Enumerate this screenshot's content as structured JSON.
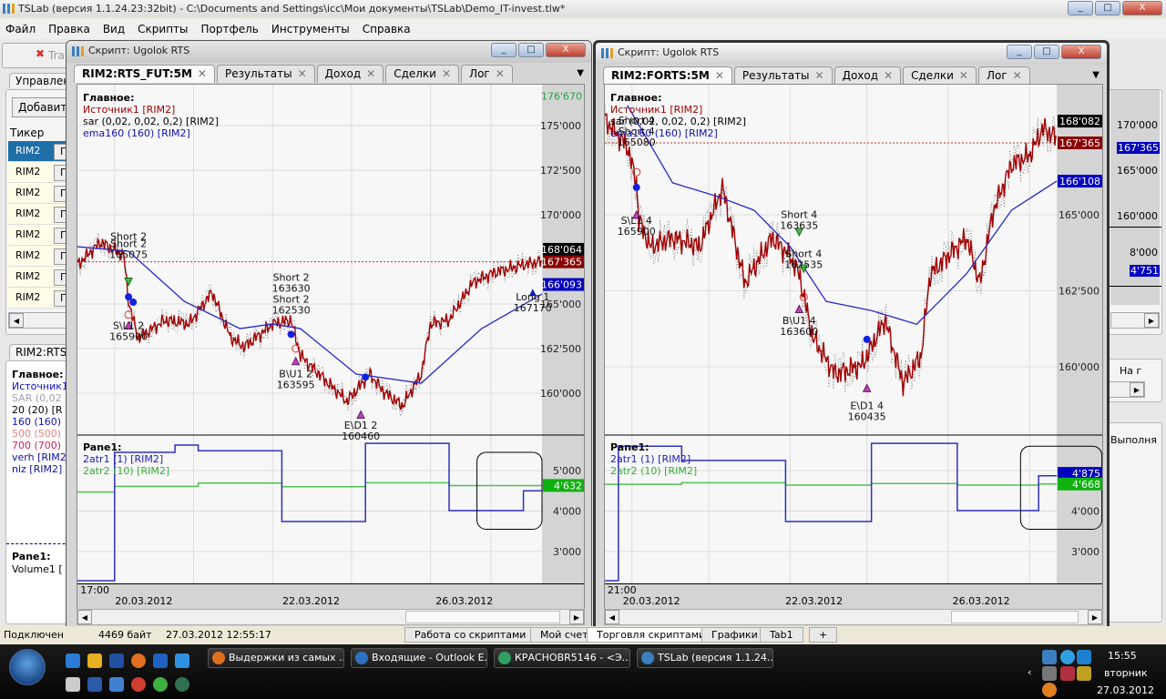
{
  "app": {
    "title": "TSLab (версия 1.1.24.23:32bit) - C:\\Documents and Settings\\icc\\Мои документы\\TSLab\\Demo_IT-invest.tlw*",
    "controls": [
      "_",
      "□",
      "X"
    ]
  },
  "menu": [
    "Файл",
    "Правка",
    "Вид",
    "Скрипты",
    "Портфель",
    "Инструменты",
    "Справка"
  ],
  "bg": {
    "toolbar_button": "Tra",
    "tab_top": "Управлен",
    "add_button": "Добавить",
    "ticker_header": "Тикер",
    "tickers": [
      "RIM2",
      "RIM2",
      "RIM2",
      "RIM2",
      "RIM2",
      "RIM2",
      "RIM2",
      "RIM2"
    ],
    "graph_btn": "Гр",
    "tab_bottom": "RIM2:RTS",
    "legend_title": "Главное:",
    "legend": [
      {
        "text": "Источник1",
        "color": "#1010c0"
      },
      {
        "text": "SAR (0,02",
        "color": "#a0a0b0"
      },
      {
        "text": "20 (20) [R",
        "color": "#000000"
      },
      {
        "text": "160 (160)",
        "color": "#1010c0"
      },
      {
        "text": "500 (500)",
        "color": "#f08080"
      },
      {
        "text": "700 (700)",
        "color": "#d02060"
      },
      {
        "text": "verh [RIM2",
        "color": "#1010a0"
      },
      {
        "text": "niz [RIM2]",
        "color": "#1010a0"
      }
    ],
    "pane_title": "Pane1:",
    "pane_line": "Volume1 [",
    "right_axis": [
      "170'000",
      "165'000",
      "160'000",
      "8'000"
    ],
    "right_tag1": "167'365",
    "right_tag2": "4'751",
    "right_col1": "На г",
    "right_col2": "Выполня"
  },
  "windows": [
    {
      "title": "Скрипт: Ugolok RTS",
      "tabs": [
        {
          "label": "RIM2:RTS_FUT:5M",
          "active": true
        },
        {
          "label": "Результаты"
        },
        {
          "label": "Доход"
        },
        {
          "label": "Сделки"
        },
        {
          "label": "Лог"
        }
      ],
      "legend_main": {
        "title": "Главное:",
        "lines": [
          {
            "text": "Источник1 [RIM2]",
            "color": "#a00000"
          },
          {
            "text": "sar (0,02, 0,02, 0,2) [RIM2]",
            "color": "#000000"
          },
          {
            "text": "ema160 (160) [RIM2]",
            "color": "#1010b0"
          }
        ]
      },
      "legend_pane": {
        "title": "Pane1:",
        "lines": [
          {
            "text": "2atr1 (1) [RIM2]",
            "color": "#2020c0"
          },
          {
            "text": "2atr2 (10) [RIM2]",
            "color": "#30b030"
          }
        ]
      },
      "time_labels": [
        {
          "text": "17:00",
          "i": 3,
          "row": 0
        },
        {
          "text": "20.03.2012",
          "i": 14,
          "row": 1
        },
        {
          "text": "22.03.2012",
          "i": 50,
          "row": 1
        },
        {
          "text": "26.03.2012",
          "i": 83,
          "row": 1
        }
      ],
      "chart_data": {
        "type": "line",
        "price_range": [
          157704,
          177296
        ],
        "atr_range": [
          2213,
          5854
        ],
        "grid_x": [
          8,
          25,
          42,
          59,
          76,
          89
        ],
        "price_ticks": [
          {
            "v": 175000,
            "label": "175'000"
          },
          {
            "v": 172500,
            "label": "172'500"
          },
          {
            "v": 170000,
            "label": "170'000"
          },
          {
            "v": 165000,
            "label": "165'000"
          },
          {
            "v": 162500,
            "label": "162'500"
          },
          {
            "v": 160000,
            "label": "160'000"
          }
        ],
        "atr_ticks": [
          {
            "v": 5000,
            "label": "5'000"
          },
          {
            "v": 4000,
            "label": "4'000"
          },
          {
            "v": 3000,
            "label": "3'000"
          }
        ],
        "price": [
          [
            0,
            167200
          ],
          [
            5,
            168470
          ],
          [
            10,
            167700
          ],
          [
            11,
            165150
          ],
          [
            13,
            163100
          ],
          [
            19,
            164100
          ],
          [
            24,
            163880
          ],
          [
            29,
            165660
          ],
          [
            33,
            163100
          ],
          [
            36,
            162600
          ],
          [
            42,
            163880
          ],
          [
            46,
            164100
          ],
          [
            48,
            162100
          ],
          [
            54,
            160560
          ],
          [
            58,
            159540
          ],
          [
            63,
            161070
          ],
          [
            66,
            160050
          ],
          [
            70,
            159290
          ],
          [
            74,
            161070
          ],
          [
            76,
            163880
          ],
          [
            80,
            164100
          ],
          [
            85,
            166170
          ],
          [
            89,
            166700
          ],
          [
            96,
            167200
          ],
          [
            100,
            167400
          ]
        ],
        "ema": [
          [
            0,
            168210
          ],
          [
            11,
            167960
          ],
          [
            23,
            165150
          ],
          [
            35,
            163620
          ],
          [
            42,
            163880
          ],
          [
            48,
            163620
          ],
          [
            60,
            161070
          ],
          [
            74,
            160560
          ],
          [
            87,
            163620
          ],
          [
            100,
            165560
          ]
        ],
        "last_line": 167365,
        "atr1": [
          [
            0,
            2280
          ],
          [
            8,
            5450
          ],
          [
            21,
            5630
          ],
          [
            26,
            5490
          ],
          [
            44,
            3740
          ],
          [
            62,
            5670
          ],
          [
            80,
            4010
          ],
          [
            96,
            4500
          ],
          [
            100,
            4500
          ]
        ],
        "atr2": [
          [
            0,
            4470
          ],
          [
            8,
            4610
          ],
          [
            26,
            4690
          ],
          [
            44,
            4600
          ],
          [
            62,
            4700
          ],
          [
            80,
            4630
          ],
          [
            100,
            4630
          ]
        ],
        "price_tags": [
          {
            "label": "176'670",
            "v": 176670,
            "bg": "none",
            "fg": "#20a040"
          },
          {
            "label": "168'064",
            "v": 168064,
            "bg": "#000000",
            "fg": "#ffffff"
          },
          {
            "label": "167'365",
            "v": 167365,
            "bg": "#8a0000",
            "fg": "#ffffff"
          },
          {
            "label": "166'093",
            "v": 166093,
            "bg": "#0000c0",
            "fg": "#ffffff"
          }
        ],
        "atr_tags": [
          {
            "label": "4'632",
            "v": 4632,
            "bg": "#10b010",
            "fg": "#ffffff"
          }
        ],
        "annotations": [
          {
            "lines": [
              "Short 2"
            ],
            "i": 11,
            "v": 168600
          },
          {
            "lines": [
              "Short 2",
              "165075"
            ],
            "i": 11,
            "v": 168200
          },
          {
            "lines": [
              "S\\L1 2",
              "165900"
            ],
            "i": 11,
            "v": 163600
          },
          {
            "lines": [
              "Short 2",
              "163630",
              "Short 2",
              "162530"
            ],
            "i": 46,
            "v": 166300
          },
          {
            "lines": [
              "B\\U1 2",
              "163595"
            ],
            "i": 47,
            "v": 160900
          },
          {
            "lines": [
              "E\\D1 2",
              "160460"
            ],
            "i": 61,
            "v": 158000
          },
          {
            "lines": [
              "Long 1",
              "167170"
            ],
            "i": 98,
            "v": 165200
          }
        ],
        "markers": [
          {
            "type": "dot",
            "i": 11,
            "v": 165400
          },
          {
            "type": "dot",
            "i": 12,
            "v": 165100
          },
          {
            "type": "dot",
            "i": 46,
            "v": 163300
          },
          {
            "type": "dot",
            "i": 62,
            "v": 160900
          },
          {
            "type": "tri",
            "i": 11,
            "v": 163800
          },
          {
            "type": "tri",
            "i": 47,
            "v": 161800
          },
          {
            "type": "tri",
            "i": 61,
            "v": 158800
          },
          {
            "type": "down",
            "i": 11,
            "v": 166200
          },
          {
            "type": "up",
            "i": 98,
            "v": 165700
          },
          {
            "type": "ring",
            "i": 11,
            "v": 164400
          },
          {
            "type": "ring",
            "i": 47,
            "v": 162500
          }
        ],
        "highlight": {
          "i0": 86,
          "i1": 100,
          "v0": 3550,
          "v1": 5450
        }
      }
    },
    {
      "title": "Скрипт: Ugolok RTS",
      "tabs": [
        {
          "label": "RIM2:FORTS:5M",
          "active": true
        },
        {
          "label": "Результаты"
        },
        {
          "label": "Доход"
        },
        {
          "label": "Сделки"
        },
        {
          "label": "Лог"
        }
      ],
      "legend_main": {
        "title": "Главное:",
        "lines": [
          {
            "text": "Источник1 [RIM2]",
            "color": "#a00000"
          },
          {
            "text": "sar (0,02, 0,02, 0,2) [RIM2]",
            "color": "#000000"
          },
          {
            "text": "ema160 (160) [RIM2]",
            "color": "#1010b0"
          }
        ]
      },
      "legend_pane": {
        "title": "Pane1:",
        "lines": [
          {
            "text": "2atr1 (1) [RIM2]",
            "color": "#2020c0"
          },
          {
            "text": "2atr2 (10) [RIM2]",
            "color": "#30b030"
          }
        ]
      },
      "time_labels": [
        {
          "text": "21:00",
          "i": 3,
          "row": 0
        },
        {
          "text": "20.03.2012",
          "i": 10,
          "row": 1
        },
        {
          "text": "22.03.2012",
          "i": 46,
          "row": 1
        },
        {
          "text": "26.03.2012",
          "i": 83,
          "row": 1
        }
      ],
      "chart_data": {
        "type": "line",
        "price_range": [
          157784,
          169281
        ],
        "atr_range": [
          2213,
          5854
        ],
        "grid_x": [
          6,
          23,
          41,
          58,
          76,
          94
        ],
        "price_ticks": [
          {
            "v": 165000,
            "label": "165'000"
          },
          {
            "v": 162500,
            "label": "162'500"
          },
          {
            "v": 160000,
            "label": "160'000"
          }
        ],
        "atr_ticks": [
          {
            "v": 5000,
            "label": "5'000"
          },
          {
            "v": 4000,
            "label": "4'000"
          },
          {
            "v": 3000,
            "label": "3'000"
          }
        ],
        "price": [
          [
            0,
            168140
          ],
          [
            5,
            167245
          ],
          [
            7,
            166050
          ],
          [
            7.5,
            164850
          ],
          [
            10,
            163950
          ],
          [
            15,
            164250
          ],
          [
            21,
            163950
          ],
          [
            26,
            165900
          ],
          [
            31,
            162750
          ],
          [
            37,
            164250
          ],
          [
            41,
            163650
          ],
          [
            43,
            163050
          ],
          [
            46,
            160960
          ],
          [
            51,
            159760
          ],
          [
            57,
            160060
          ],
          [
            62,
            161560
          ],
          [
            66,
            159460
          ],
          [
            70,
            160360
          ],
          [
            72,
            163050
          ],
          [
            80,
            164250
          ],
          [
            83,
            162750
          ],
          [
            86,
            165150
          ],
          [
            90,
            166650
          ],
          [
            94,
            166950
          ],
          [
            97,
            167840
          ],
          [
            100,
            167540
          ]
        ],
        "ema": [
          [
            5,
            168600
          ],
          [
            15,
            166050
          ],
          [
            25,
            165600
          ],
          [
            33,
            165150
          ],
          [
            41,
            163950
          ],
          [
            49,
            162150
          ],
          [
            59,
            161850
          ],
          [
            69,
            161400
          ],
          [
            80,
            163050
          ],
          [
            90,
            165150
          ],
          [
            100,
            166108
          ]
        ],
        "last_line": 167365,
        "atr1": [
          [
            0,
            2280
          ],
          [
            3,
            5600
          ],
          [
            17,
            5250
          ],
          [
            40,
            3740
          ],
          [
            59,
            5670
          ],
          [
            78,
            4010
          ],
          [
            96,
            4870
          ],
          [
            100,
            4870
          ]
        ],
        "atr2": [
          [
            0,
            4660
          ],
          [
            17,
            4700
          ],
          [
            40,
            4640
          ],
          [
            59,
            4680
          ],
          [
            78,
            4640
          ],
          [
            96,
            4668
          ],
          [
            100,
            4668
          ]
        ],
        "price_tags": [
          {
            "label": "168'082",
            "v": 168082,
            "bg": "#000000",
            "fg": "#ffffff"
          },
          {
            "label": "167'365",
            "v": 167365,
            "bg": "#8a0000",
            "fg": "#ffffff"
          },
          {
            "label": "166'108",
            "v": 166108,
            "bg": "#0000c0",
            "fg": "#ffffff"
          }
        ],
        "atr_tags": [
          {
            "label": "4'875",
            "v": 4930,
            "bg": "#0000c0",
            "fg": "#ffffff"
          },
          {
            "label": "4'668",
            "v": 4668,
            "bg": "#10b010",
            "fg": "#ffffff"
          }
        ],
        "annotations": [
          {
            "lines": [
              "Short 4",
              "Short 4",
              "165080"
            ],
            "i": 7,
            "v": 168000
          },
          {
            "lines": [
              "S\\L1 4",
              "165900"
            ],
            "i": 7,
            "v": 164700
          },
          {
            "lines": [
              "Short 4",
              "163635"
            ],
            "i": 43,
            "v": 164900
          },
          {
            "lines": [
              "Short 4",
              "162535"
            ],
            "i": 44,
            "v": 163600
          },
          {
            "lines": [
              "B\\U1 4",
              "163600"
            ],
            "i": 43,
            "v": 161400
          },
          {
            "lines": [
              "E\\D1 4",
              "160435"
            ],
            "i": 58,
            "v": 158600
          },
          {
            "lines": [],
            "i": 0,
            "v": 0
          }
        ],
        "markers": [
          {
            "type": "dot",
            "i": 7,
            "v": 165900
          },
          {
            "type": "dot",
            "i": 58,
            "v": 160900
          },
          {
            "type": "tri",
            "i": 7,
            "v": 165000
          },
          {
            "type": "tri",
            "i": 43,
            "v": 161900
          },
          {
            "type": "tri",
            "i": 58,
            "v": 159300
          },
          {
            "type": "down",
            "i": 43,
            "v": 164400
          },
          {
            "type": "down",
            "i": 44,
            "v": 163200
          },
          {
            "type": "ring",
            "i": 7,
            "v": 166400
          },
          {
            "type": "ring",
            "i": 44,
            "v": 162300
          }
        ],
        "highlight": {
          "i0": 92,
          "i1": 110,
          "v0": 3550,
          "v1": 5600
        }
      }
    }
  ],
  "status": {
    "connected": "Подключен",
    "bytes": "4469 байт",
    "time": "27.03.2012 12:55:17",
    "tabs": [
      {
        "label": "Работа со скриптами"
      },
      {
        "label": "Мой счет"
      },
      {
        "label": "Торговля скриптами",
        "active": true
      },
      {
        "label": "Графики"
      },
      {
        "label": "Tab1"
      },
      {
        "label": "+"
      }
    ]
  },
  "taskbar": {
    "tasks": [
      {
        "label": "Выдержки из самых ...",
        "color": "#e07020"
      },
      {
        "label": "Входящие - Outlook E...",
        "color": "#3070c0"
      },
      {
        "label": "КРАСНОВR5146 - <Э...",
        "color": "#30a060"
      },
      {
        "label": "TSLab (версия 1.1.24...",
        "color": "#3a7fc0"
      }
    ],
    "clock": "15:55",
    "day": "вторник",
    "date": "27.03.2012"
  }
}
